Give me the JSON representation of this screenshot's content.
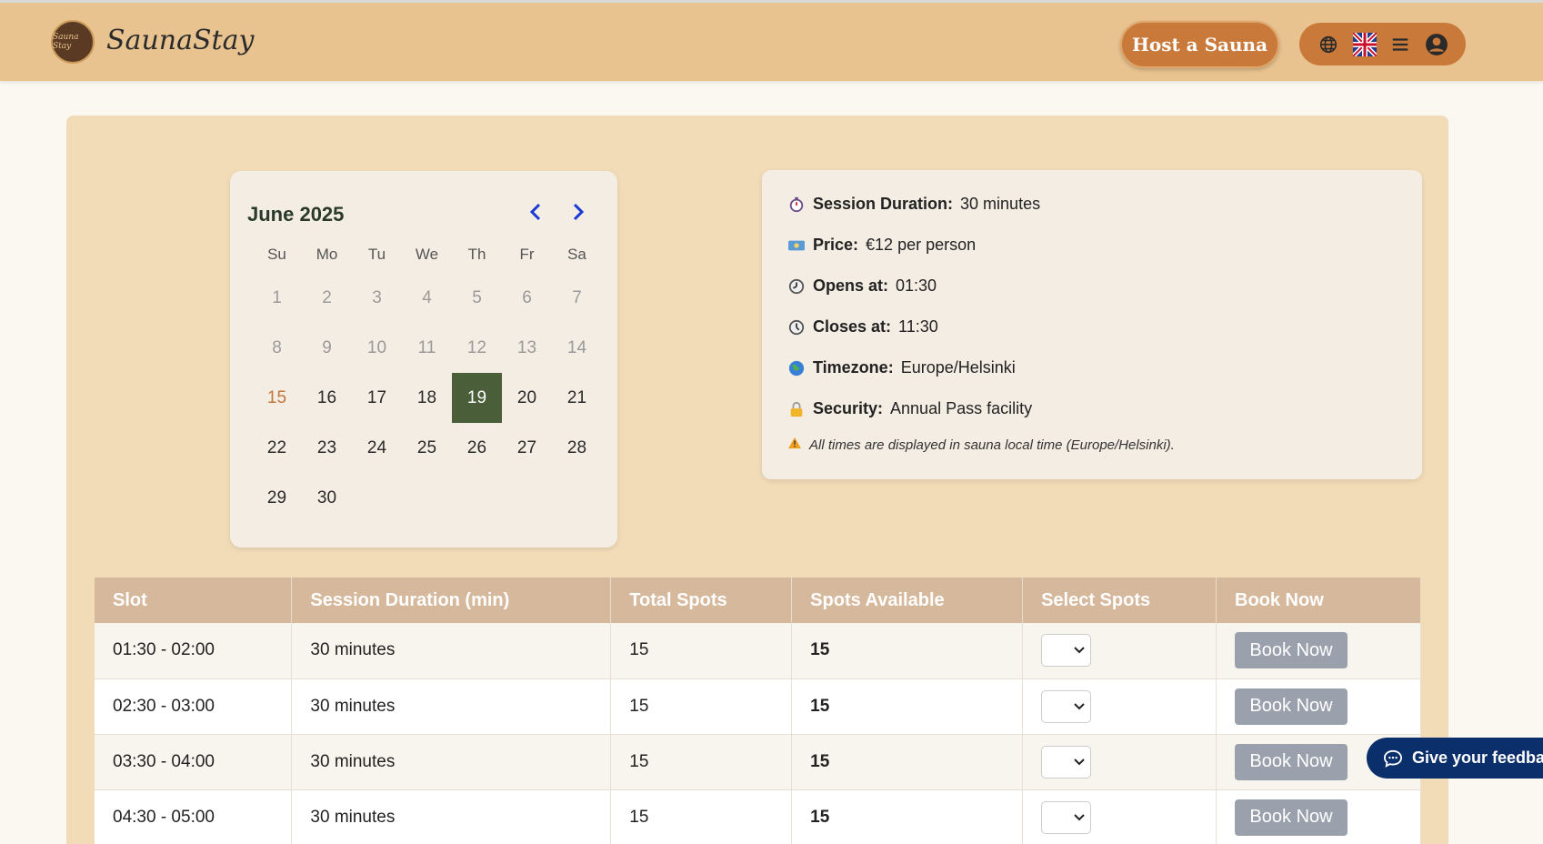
{
  "header": {
    "brand": "SaunaStay",
    "logo_text": "Sauna Stay",
    "host_button": "Host a Sauna",
    "icons": [
      "globe-icon",
      "uk-flag-icon",
      "hamburger-menu-icon",
      "user-account-icon"
    ]
  },
  "calendar": {
    "month_label": "June 2025",
    "weekdays": [
      "Su",
      "Mo",
      "Tu",
      "We",
      "Th",
      "Fr",
      "Sa"
    ],
    "weeks": [
      [
        "1",
        "2",
        "3",
        "4",
        "5",
        "6",
        "7"
      ],
      [
        "8",
        "9",
        "10",
        "11",
        "12",
        "13",
        "14"
      ],
      [
        "15",
        "16",
        "17",
        "18",
        "19",
        "20",
        "21"
      ],
      [
        "22",
        "23",
        "24",
        "25",
        "26",
        "27",
        "28"
      ],
      [
        "29",
        "30",
        "",
        "",
        "",
        "",
        ""
      ]
    ],
    "today": "15",
    "selected": "19"
  },
  "info": {
    "duration_label": "Session Duration:",
    "duration_value": "30 minutes",
    "price_label": "Price:",
    "price_value": "€12 per person",
    "opens_label": "Opens at:",
    "opens_value": "01:30",
    "closes_label": "Closes at:",
    "closes_value": "11:30",
    "timezone_label": "Timezone:",
    "timezone_value": "Europe/Helsinki",
    "security_label": "Security:",
    "security_value": "Annual Pass facility",
    "note": "All times are displayed in sauna local time (Europe/Helsinki)."
  },
  "table": {
    "headers": [
      "Slot",
      "Session Duration (min)",
      "Total Spots",
      "Spots Available",
      "Select Spots",
      "Book Now"
    ],
    "rows": [
      {
        "slot": "01:30 - 02:00",
        "duration": "30 minutes",
        "total": "15",
        "available": "15",
        "book": "Book Now"
      },
      {
        "slot": "02:30 - 03:00",
        "duration": "30 minutes",
        "total": "15",
        "available": "15",
        "book": "Book Now"
      },
      {
        "slot": "03:30 - 04:00",
        "duration": "30 minutes",
        "total": "15",
        "available": "15",
        "book": "Book Now"
      },
      {
        "slot": "04:30 - 05:00",
        "duration": "30 minutes",
        "total": "15",
        "available": "15",
        "book": "Book Now"
      }
    ]
  },
  "feedback": {
    "label": "Give your feedbac"
  },
  "colors": {
    "header_bg": "#e8c38f",
    "accent": "#c97a3a",
    "selected_day": "#4a5e3a",
    "table_header": "#d6b89c",
    "button_disabled": "#9aa1ad",
    "feedback_bg": "#0b2f6b"
  }
}
